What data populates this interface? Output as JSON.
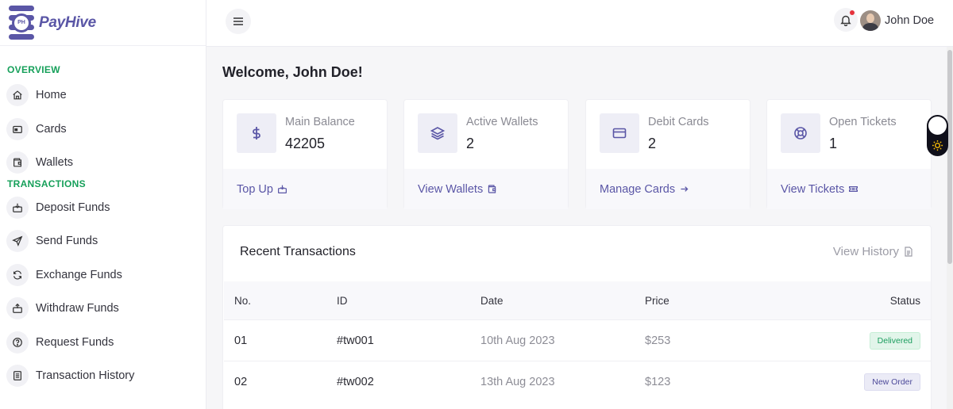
{
  "brand": {
    "name": "PayHive",
    "mark": "PH"
  },
  "sidebar": {
    "overview_title": "OVERVIEW",
    "overview_items": [
      {
        "label": "Home",
        "icon": "home-icon"
      },
      {
        "label": "Cards",
        "icon": "card-icon"
      },
      {
        "label": "Wallets",
        "icon": "wallet-icon"
      }
    ],
    "transactions_title": "TRANSACTIONS",
    "transaction_items": [
      {
        "label": "Deposit Funds",
        "icon": "deposit-icon"
      },
      {
        "label": "Send Funds",
        "icon": "send-icon"
      },
      {
        "label": "Exchange Funds",
        "icon": "exchange-icon"
      },
      {
        "label": "Withdraw Funds",
        "icon": "withdraw-icon"
      },
      {
        "label": "Request Funds",
        "icon": "request-icon"
      },
      {
        "label": "Transaction History",
        "icon": "history-icon"
      }
    ]
  },
  "topbar": {
    "user_name": "John Doe",
    "has_notification": true
  },
  "welcome": "Welcome, John Doe!",
  "stats": [
    {
      "label": "Main Balance",
      "value": "42205",
      "link": "Top Up",
      "icon": "dollar-icon",
      "link_icon": "deposit-icon"
    },
    {
      "label": "Active Wallets",
      "value": "2",
      "link": "View Wallets",
      "icon": "layers-icon",
      "link_icon": "wallet-icon"
    },
    {
      "label": "Debit Cards",
      "value": "2",
      "link": "Manage Cards",
      "icon": "card-icon",
      "link_icon": "arrow-right-icon"
    },
    {
      "label": "Open Tickets",
      "value": "1",
      "link": "View Tickets",
      "icon": "lifebuoy-icon",
      "link_icon": "ticket-icon"
    }
  ],
  "transactions": {
    "title": "Recent Transactions",
    "history_link": "View History",
    "columns": [
      "No.",
      "ID",
      "Date",
      "Price",
      "Status"
    ],
    "rows": [
      {
        "no": "01",
        "id": "#tw001",
        "date": "10th Aug 2023",
        "price": "$253",
        "status": "Delivered"
      },
      {
        "no": "02",
        "id": "#tw002",
        "date": "13th Aug 2023",
        "price": "$123",
        "status": "New Order"
      }
    ]
  },
  "colors": {
    "accent": "#5a56a6",
    "section": "#16a05a",
    "delivered": "#1b9d5e",
    "alert": "#e5323b"
  }
}
